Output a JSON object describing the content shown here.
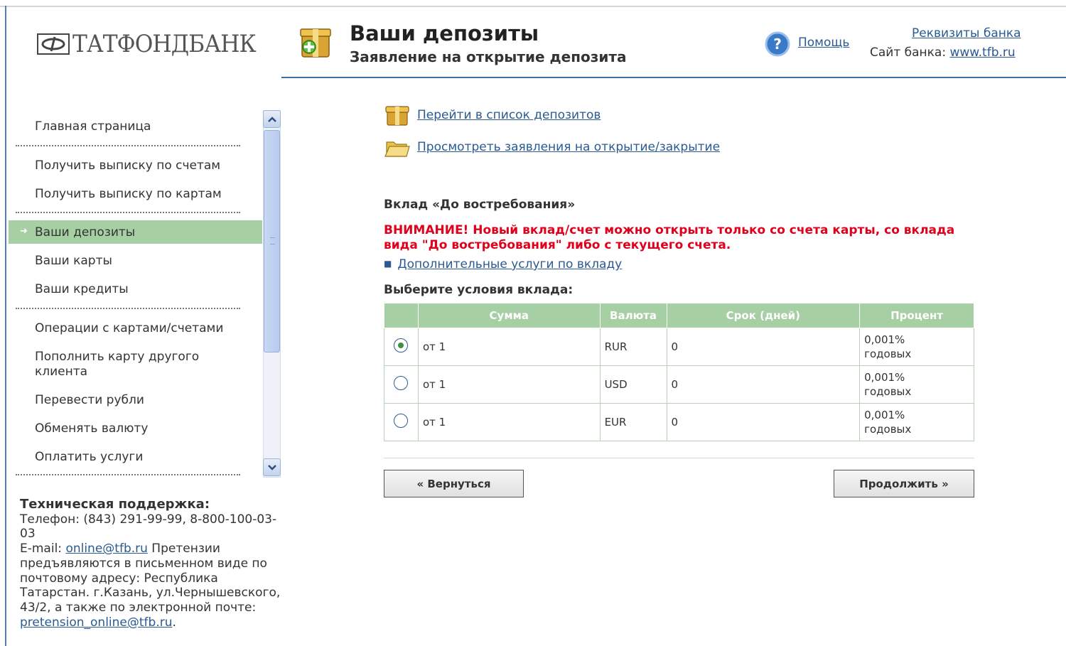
{
  "logo": {
    "text": "ТАТФОНДБАНК"
  },
  "header": {
    "title": "Ваши депозиты",
    "subtitle": "Заявление на открытие депозита",
    "help_label": "Помощь",
    "requisites_label": "Реквизиты банка",
    "site_prefix": "Сайт банка: ",
    "site_link": "www.tfb.ru"
  },
  "sidebar": {
    "items": [
      {
        "label": "Главная страница"
      },
      {
        "label": "Получить выписку по счетам"
      },
      {
        "label": "Получить выписку по картам"
      },
      {
        "label": "Ваши депозиты",
        "active": true
      },
      {
        "label": "Ваши карты"
      },
      {
        "label": "Ваши кредиты"
      },
      {
        "label": "Операции с картами/счетами"
      },
      {
        "label": "Пополнить карту другого клиента"
      },
      {
        "label": "Перевести рубли"
      },
      {
        "label": "Обменять валюту"
      },
      {
        "label": "Оплатить услуги"
      }
    ]
  },
  "support": {
    "title": "Техническая поддержка:",
    "phone": "Телефон:  (843) 291-99-99, 8-800-100-03-03",
    "email_prefix": "E-mail:  ",
    "email": "online@tfb.ru",
    "claims_text": " Претензии предъявляются в письменном виде по почтовому адресу: Республика Татарстан. г.Казань, ул.Чернышевского, 43/2, а также по электронной почте: ",
    "claims_email": "pretension_online@tfb.ru",
    "end": "."
  },
  "main": {
    "links": [
      {
        "label": "Перейти в список депозитов",
        "icon": "gift-box-icon"
      },
      {
        "label": "Просмотреть заявления на открытие/закрытие",
        "icon": "folder-icon"
      }
    ],
    "deposit_title": "Вклад «До востребования»",
    "warning": "ВНИМАНИЕ! Новый вклад/счет можно открыть только со счета карты, со вклада вида \"До востребования\" либо с текущего счета.",
    "extra_services": "Дополнительные услуги по вкладу",
    "conditions_label": "Выберите условия вклада:",
    "table": {
      "headers": [
        "",
        "Сумма",
        "Валюта",
        "Срок (дней)",
        "Процент"
      ],
      "rows": [
        {
          "amount": "от 1",
          "currency": "RUR",
          "term": "0",
          "percent": "0,001%",
          "percent_unit": "годовых",
          "selected": true
        },
        {
          "amount": "от 1",
          "currency": "USD",
          "term": "0",
          "percent": "0,001%",
          "percent_unit": "годовых",
          "selected": false
        },
        {
          "amount": "от 1",
          "currency": "EUR",
          "term": "0",
          "percent": "0,001%",
          "percent_unit": "годовых",
          "selected": false
        }
      ]
    },
    "back_button": "« Вернуться",
    "continue_button": "Продолжить »"
  },
  "colors": {
    "accent_green": "#a6cfa4",
    "link_blue": "#2a5a92",
    "warning_red": "#e0001b",
    "header_rule": "#3f6e9e"
  }
}
